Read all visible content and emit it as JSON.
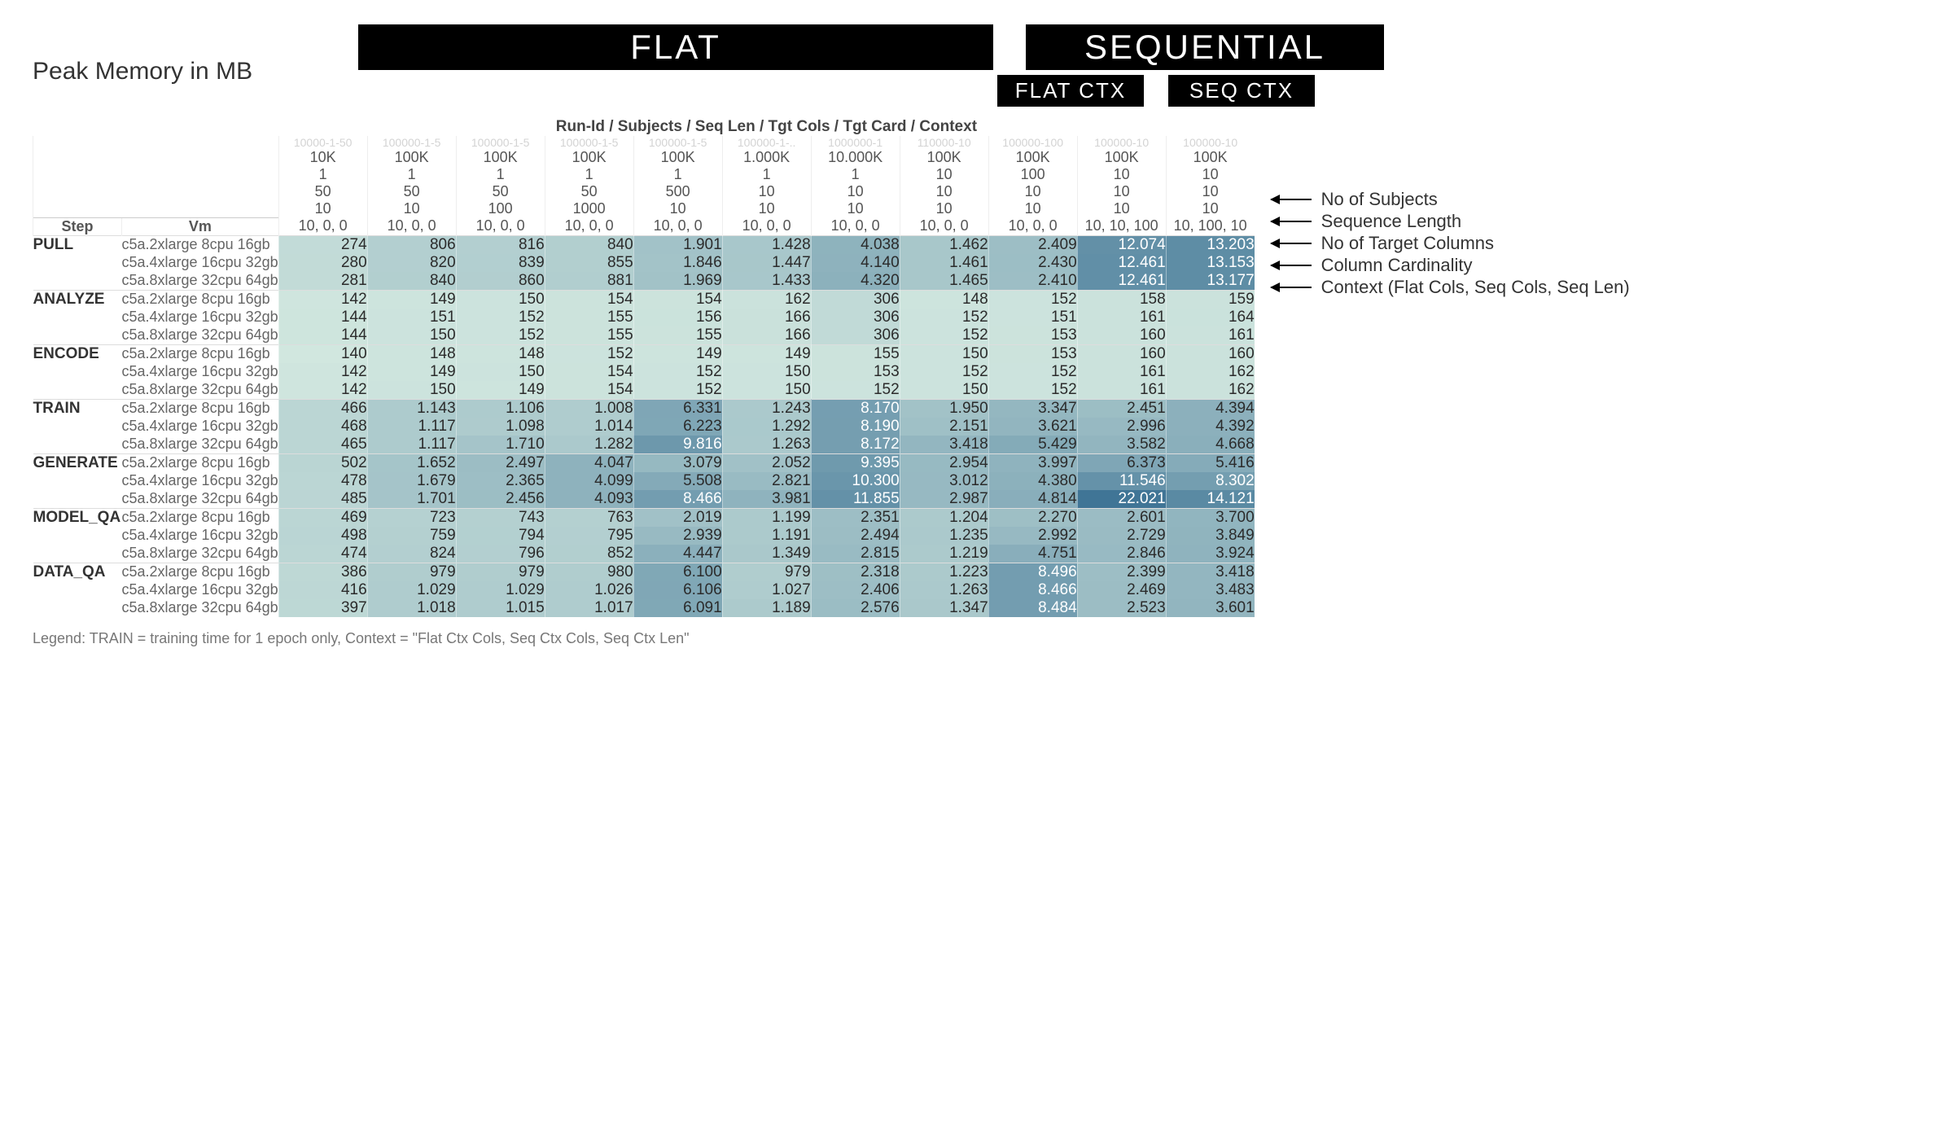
{
  "banners": {
    "flat": "FLAT",
    "sequential": "SEQUENTIAL",
    "flat_ctx": "FLAT CTX",
    "seq_ctx": "SEQ CTX"
  },
  "title": "Peak Memory in MB",
  "column_caption": "Run-Id / Subjects / Seq Len / Tgt Cols / Tgt Card / Context",
  "left_headers": {
    "step": "Step",
    "vm": "Vm"
  },
  "right_legend": [
    "No of Subjects",
    "Sequence Length",
    "No of Target Columns",
    "Column Cardinality",
    "Context (Flat Cols, Seq Cols, Seq Len)"
  ],
  "footer": "Legend: TRAIN = training time for 1 epoch only, Context = \"Flat Ctx Cols, Seq Ctx Cols, Seq Ctx Len\"",
  "chart_data": {
    "type": "heatmap",
    "vm_labels": [
      "c5a.2xlarge 8cpu 16gb",
      "c5a.4xlarge 16cpu 32gb",
      "c5a.8xlarge 32cpu 64gb"
    ],
    "steps": [
      "PULL",
      "ANALYZE",
      "ENCODE",
      "TRAIN",
      "GENERATE",
      "MODEL_QA",
      "DATA_QA"
    ],
    "column_meta_rows": {
      "faded_id": [
        "10000-1-50",
        "100000-1-5",
        "100000-1-5",
        "100000-1-5",
        "100000-1-5",
        "100000-1-..",
        "1000000-1",
        "110000-10",
        "100000-100",
        "100000-10",
        "100000-10"
      ],
      "subjects": [
        "10K",
        "100K",
        "100K",
        "100K",
        "100K",
        "1.000K",
        "10.000K",
        "100K",
        "100K",
        "100K",
        "100K"
      ],
      "seq_len": [
        "1",
        "1",
        "1",
        "1",
        "1",
        "1",
        "1",
        "10",
        "100",
        "10",
        "10"
      ],
      "tgt_cols": [
        "50",
        "50",
        "50",
        "50",
        "500",
        "10",
        "10",
        "10",
        "10",
        "10",
        "10"
      ],
      "tgt_card": [
        "10",
        "10",
        "100",
        "1000",
        "10",
        "10",
        "10",
        "10",
        "10",
        "10",
        "10"
      ],
      "context": [
        "10, 0, 0",
        "10, 0, 0",
        "10, 0, 0",
        "10, 0, 0",
        "10, 0, 0",
        "10, 0, 0",
        "10, 0, 0",
        "10, 0, 0",
        "10, 0, 0",
        "10, 10, 100",
        "10, 100, 10"
      ]
    },
    "values": {
      "PULL": [
        [
          274,
          806,
          816,
          840,
          1.901,
          1.428,
          4.038,
          1.462,
          2.409,
          12.074,
          13.203
        ],
        [
          280,
          820,
          839,
          855,
          1.846,
          1.447,
          4.14,
          1.461,
          2.43,
          12.461,
          13.153
        ],
        [
          281,
          840,
          860,
          881,
          1.969,
          1.433,
          4.32,
          1.465,
          2.41,
          12.461,
          13.177
        ]
      ],
      "ANALYZE": [
        [
          142,
          149,
          150,
          154,
          154,
          162,
          306,
          148,
          152,
          158,
          159
        ],
        [
          144,
          151,
          152,
          155,
          156,
          166,
          306,
          152,
          151,
          161,
          164
        ],
        [
          144,
          150,
          152,
          155,
          155,
          166,
          306,
          152,
          153,
          160,
          161
        ]
      ],
      "ENCODE": [
        [
          140,
          148,
          148,
          152,
          149,
          149,
          155,
          150,
          153,
          160,
          160
        ],
        [
          142,
          149,
          150,
          154,
          152,
          150,
          153,
          152,
          152,
          161,
          162
        ],
        [
          142,
          150,
          149,
          154,
          152,
          150,
          152,
          150,
          152,
          161,
          162
        ]
      ],
      "TRAIN": [
        [
          466,
          1.143,
          1.106,
          1.008,
          6.331,
          1.243,
          8.17,
          1.95,
          3.347,
          2.451,
          4.394
        ],
        [
          468,
          1.117,
          1.098,
          1.014,
          6.223,
          1.292,
          8.19,
          2.151,
          3.621,
          2.996,
          4.392
        ],
        [
          465,
          1.117,
          1.71,
          1.282,
          9.816,
          1.263,
          8.172,
          3.418,
          5.429,
          3.582,
          4.668
        ]
      ],
      "GENERATE": [
        [
          502,
          1.652,
          2.497,
          4.047,
          3.079,
          2.052,
          9.395,
          2.954,
          3.997,
          6.373,
          5.416
        ],
        [
          478,
          1.679,
          2.365,
          4.099,
          5.508,
          2.821,
          10.3,
          3.012,
          4.38,
          11.546,
          8.302
        ],
        [
          485,
          1.701,
          2.456,
          4.093,
          8.466,
          3.981,
          11.855,
          2.987,
          4.814,
          22.021,
          14.121
        ]
      ],
      "MODEL_QA": [
        [
          469,
          723,
          743,
          763,
          2.019,
          1.199,
          2.351,
          1.204,
          2.27,
          2.601,
          3.7
        ],
        [
          498,
          759,
          794,
          795,
          2.939,
          1.191,
          2.494,
          1.235,
          2.992,
          2.729,
          3.849
        ],
        [
          474,
          824,
          796,
          852,
          4.447,
          1.349,
          2.815,
          1.219,
          4.751,
          2.846,
          3.924
        ]
      ],
      "DATA_QA": [
        [
          386,
          979,
          979,
          980,
          6.1,
          979,
          2.318,
          1.223,
          8.496,
          2.399,
          3.418
        ],
        [
          416,
          1.029,
          1.029,
          1.026,
          6.106,
          1.027,
          2.406,
          1.263,
          8.466,
          2.469,
          3.483
        ],
        [
          397,
          1.018,
          1.015,
          1.017,
          6.091,
          1.189,
          2.576,
          1.347,
          8.484,
          2.523,
          3.601
        ]
      ]
    }
  }
}
